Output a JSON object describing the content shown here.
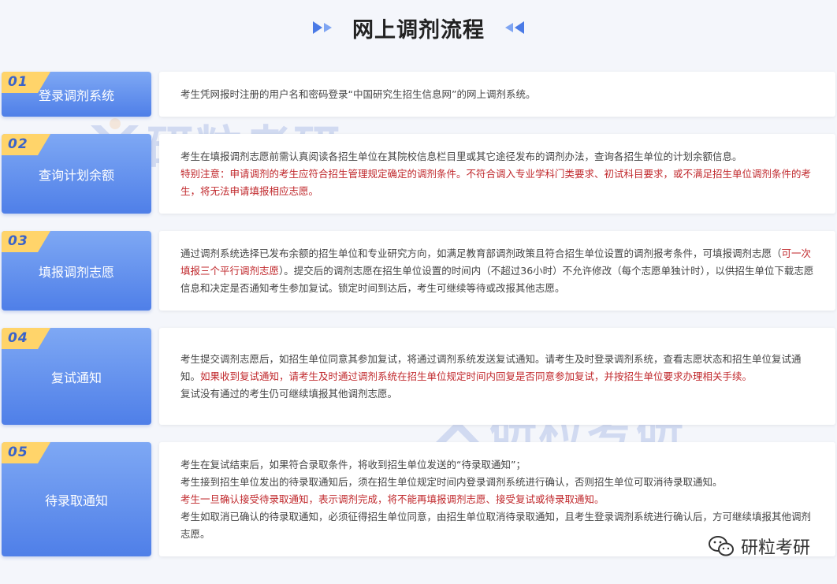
{
  "header": {
    "title": "网上调剂流程"
  },
  "colors": {
    "accent": "#5b8cf0",
    "highlight": "#c0282c",
    "badge_number": "#3a63c9",
    "tab_yellow": "#ffd46a"
  },
  "watermark": {
    "text": "研粒考研"
  },
  "footer": {
    "brand": "研粒考研",
    "icon": "wechat-icon"
  },
  "steps": [
    {
      "number": "01",
      "label": "登录调剂系统",
      "lines": [
        [
          {
            "t": "考生凭网报时注册的用户名和密码登录“中国研究生招生信息网”的网上调剂系统。",
            "red": false
          }
        ]
      ]
    },
    {
      "number": "02",
      "label": "查询计划余额",
      "lines": [
        [
          {
            "t": "考生在填报调剂志愿前需认真阅读各招生单位在其院校信息栏目里或其它途径发布的调剂办法，查询各招生单位的计划余额信息。",
            "red": false
          }
        ],
        [
          {
            "t": "特别注意：申请调剂的考生应符合招生管理规定确定的调剂条件。不符合调入专业学科门类要求、初试科目要求，或不满足招生单位调剂条件的考生，将无法申请填报相应志愿。",
            "red": true
          }
        ]
      ]
    },
    {
      "number": "03",
      "label": "填报调剂志愿",
      "lines": [
        [
          {
            "t": "通过调剂系统选择已发布余额的招生单位和专业研究方向，如满足教育部调剂政策且符合招生单位设置的调剂报考条件，可填报调剂志愿（",
            "red": false
          },
          {
            "t": "可一次填报三个平行调剂志愿",
            "red": true
          },
          {
            "t": "）。提交后的调剂志愿在招生单位设置的时间内（不超过36小时）不允许修改（每个志愿单独计时），以供招生单位下载志愿信息和决定是否通知考生参加复试。锁定时间到达后，考生可继续等待或改报其他志愿。",
            "red": false
          }
        ]
      ]
    },
    {
      "number": "04",
      "label": "复试通知",
      "lines": [
        [
          {
            "t": "考生提交调剂志愿后，如招生单位同意其参加复试，将通过调剂系统发送复试通知。请考生及时登录调剂系统，查看志愿状态和招生单位复试通知。",
            "red": false
          },
          {
            "t": "如果收到复试通知，请考生及时通过调剂系统在招生单位规定时间内回复是否同意参加复试，并按招生单位要求办理相关手续。",
            "red": true
          }
        ],
        [
          {
            "t": "复试没有通过的考生仍可继续填报其他调剂志愿。",
            "red": false
          }
        ]
      ]
    },
    {
      "number": "05",
      "label": "待录取通知",
      "lines": [
        [
          {
            "t": "考生在复试结束后，如果符合录取条件，将收到招生单位发送的“待录取通知”；",
            "red": false
          }
        ],
        [
          {
            "t": "考生接到招生单位发出的待录取通知后，须在招生单位规定时间内登录调剂系统进行确认，否则招生单位可取消待录取通知。",
            "red": false
          }
        ],
        [
          {
            "t": "考生一旦确认接受待录取通知，表示调剂完成，将不能再填报调剂志愿、接受复试或待录取通知。",
            "red": true
          }
        ],
        [
          {
            "t": "考生如取消已确认的待录取通知，必须征得招生单位同意，由招生单位取消待录取通知，且考生登录调剂系统进行确认后，方可继续填报其他调剂志愿。",
            "red": false
          }
        ]
      ]
    }
  ]
}
